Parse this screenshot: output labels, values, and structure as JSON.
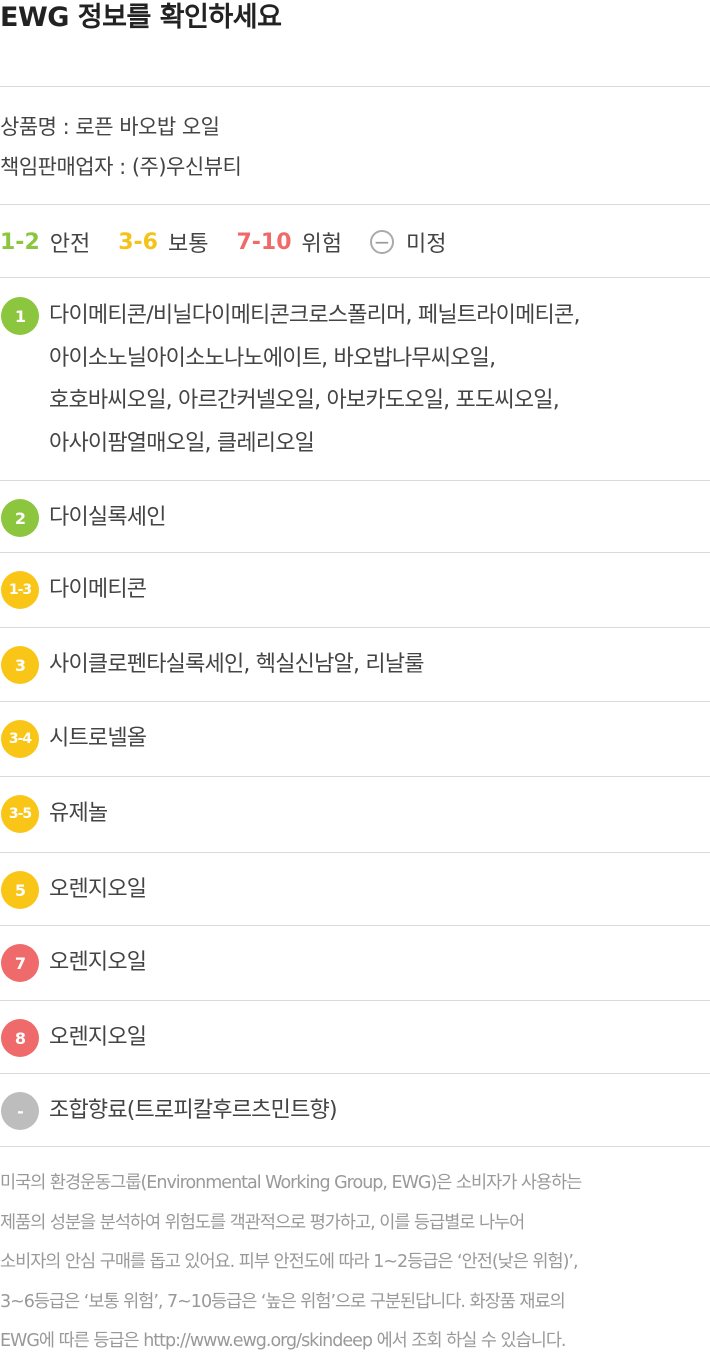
{
  "title": "EWG 정보를 확인하세요",
  "product": {
    "name_line": "상품명 : 로픈 바오밥 오일",
    "seller_line": "책임판매업자 : (주)우신뷰티"
  },
  "legend": {
    "safe_range": "1-2",
    "safe_label": "안전",
    "moderate_range": "3-6",
    "moderate_label": "보통",
    "high_range": "7-10",
    "high_label": "위험",
    "none_label": "미정"
  },
  "colors": {
    "green": "#8cc63f",
    "yellow": "#f9c517",
    "red": "#ef6a6a",
    "gray": "#bdbdbd"
  },
  "ingredients": [
    {
      "grade": "1",
      "level": "green",
      "lines": [
        "다이메티콘/비닐다이메티콘크로스폴리머, 페닐트라이메티콘,",
        "아이소노닐아이소노나노에이트, 바오밥나무씨오일,",
        "호호바씨오일, 아르간커넬오일, 아보카도오일, 포도씨오일,",
        "아사이팜열매오일, 클레리오일"
      ]
    },
    {
      "grade": "2",
      "level": "green",
      "lines": [
        "다이실록세인"
      ]
    },
    {
      "grade": "1-3",
      "level": "yellow",
      "lines": [
        "다이메티콘"
      ]
    },
    {
      "grade": "3",
      "level": "yellow",
      "lines": [
        "사이클로펜타실록세인, 헥실신남알, 리날룰"
      ]
    },
    {
      "grade": "3-4",
      "level": "yellow",
      "lines": [
        "시트로넬올"
      ]
    },
    {
      "grade": "3-5",
      "level": "yellow",
      "lines": [
        "유제놀"
      ]
    },
    {
      "grade": "5",
      "level": "yellow",
      "lines": [
        "오렌지오일"
      ]
    },
    {
      "grade": "7",
      "level": "red",
      "lines": [
        "오렌지오일"
      ]
    },
    {
      "grade": "8",
      "level": "red",
      "lines": [
        "오렌지오일"
      ]
    },
    {
      "grade": "-",
      "level": "gray",
      "lines": [
        "조합향료(트로피칼후르츠민트향)"
      ]
    }
  ],
  "note_lines": [
    "미국의 환경운동그룹(Environmental Working Group, EWG)은 소비자가 사용하는",
    "제품의 성분을 분석하여 위험도를 객관적으로 평가하고, 이를 등급별로 나누어",
    "소비자의 안심 구매를 돕고 있어요. 피부 안전도에 따라 1~2등급은 ‘안전(낮은 위험)’,",
    "3~6등급은 ‘보통 위험’, 7~10등급은 ‘높은 위험’으로 구분된답니다. 화장품 재료의",
    "EWG에 따른 등급은 http://www.ewg.org/skindeep 에서 조회 하실 수 있습니다."
  ]
}
